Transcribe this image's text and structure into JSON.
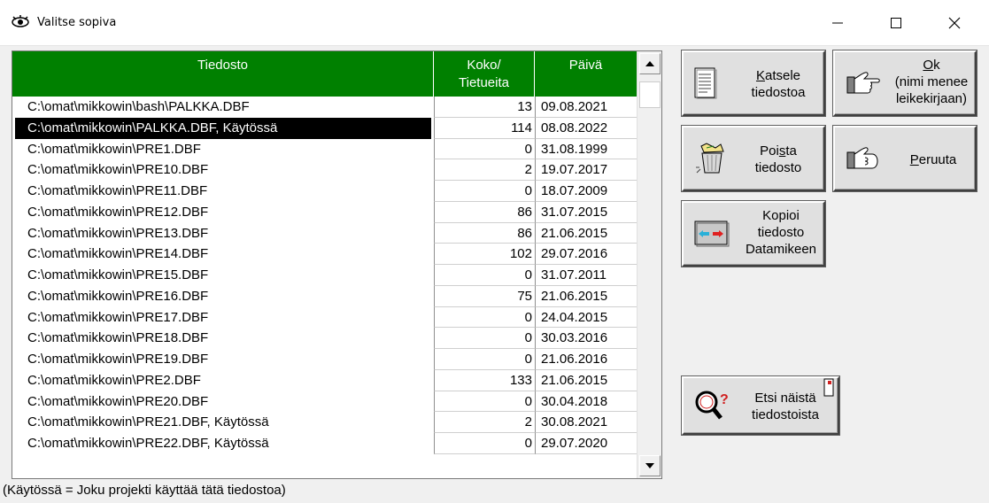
{
  "window": {
    "title": "Valitse sopiva"
  },
  "columns": {
    "file": "Tiedosto",
    "size_line1": "Koko/",
    "size_line2": "Tietueita",
    "date": "Päivä"
  },
  "rows": [
    {
      "file": "C:\\omat\\mikkowin\\bash\\PALKKA.DBF",
      "size": "13",
      "date": "09.08.2021",
      "selected": false
    },
    {
      "file": "C:\\omat\\mikkowin\\PALKKA.DBF, Käytössä",
      "size": "114",
      "date": "08.08.2022",
      "selected": true
    },
    {
      "file": "C:\\omat\\mikkowin\\PRE1.DBF",
      "size": "0",
      "date": "31.08.1999",
      "selected": false
    },
    {
      "file": "C:\\omat\\mikkowin\\PRE10.DBF",
      "size": "2",
      "date": "19.07.2017",
      "selected": false
    },
    {
      "file": "C:\\omat\\mikkowin\\PRE11.DBF",
      "size": "0",
      "date": "18.07.2009",
      "selected": false
    },
    {
      "file": "C:\\omat\\mikkowin\\PRE12.DBF",
      "size": "86",
      "date": "31.07.2015",
      "selected": false
    },
    {
      "file": "C:\\omat\\mikkowin\\PRE13.DBF",
      "size": "86",
      "date": "21.06.2015",
      "selected": false
    },
    {
      "file": "C:\\omat\\mikkowin\\PRE14.DBF",
      "size": "102",
      "date": "29.07.2016",
      "selected": false
    },
    {
      "file": "C:\\omat\\mikkowin\\PRE15.DBF",
      "size": "0",
      "date": "31.07.2011",
      "selected": false
    },
    {
      "file": "C:\\omat\\mikkowin\\PRE16.DBF",
      "size": "75",
      "date": "21.06.2015",
      "selected": false
    },
    {
      "file": "C:\\omat\\mikkowin\\PRE17.DBF",
      "size": "0",
      "date": "24.04.2015",
      "selected": false
    },
    {
      "file": "C:\\omat\\mikkowin\\PRE18.DBF",
      "size": "0",
      "date": "30.03.2016",
      "selected": false
    },
    {
      "file": "C:\\omat\\mikkowin\\PRE19.DBF",
      "size": "0",
      "date": "21.06.2016",
      "selected": false
    },
    {
      "file": "C:\\omat\\mikkowin\\PRE2.DBF",
      "size": "133",
      "date": "21.06.2015",
      "selected": false
    },
    {
      "file": "C:\\omat\\mikkowin\\PRE20.DBF",
      "size": "0",
      "date": "30.04.2018",
      "selected": false
    },
    {
      "file": "C:\\omat\\mikkowin\\PRE21.DBF, Käytössä",
      "size": "2",
      "date": "30.08.2021",
      "selected": false
    },
    {
      "file": "C:\\omat\\mikkowin\\PRE22.DBF, Käytössä",
      "size": "0",
      "date": "29.07.2020",
      "selected": false
    }
  ],
  "buttons": {
    "view": {
      "line1_u": "K",
      "line1_rest": "atsele",
      "line2": "tiedostoa",
      "icon": "document-icon"
    },
    "ok": {
      "line1_u": "O",
      "line1_rest": "k",
      "line2": "(nimi menee",
      "line3": "leikekirjaan)",
      "icon": "hand-pointing-icon"
    },
    "delete": {
      "line1_pre": "Poi",
      "line1_u": "s",
      "line1_rest": "ta",
      "line2": "tiedosto",
      "icon": "trash-icon"
    },
    "cancel": {
      "line1_u": "P",
      "line1_rest": "eruuta",
      "icon": "hand-back-icon"
    },
    "copy": {
      "line1": "Kopioi",
      "line2": "tiedosto",
      "line3": "Datamikeen",
      "icon": "transfer-icon"
    },
    "search": {
      "line1": "Etsi näistä",
      "line2": "tiedostoista",
      "icon": "magnifier-question-icon"
    }
  },
  "status_text": "(Käytössä = Joku projekti käyttää tätä tiedostoa)",
  "colors": {
    "header": "#008000",
    "selection": "#000000"
  }
}
